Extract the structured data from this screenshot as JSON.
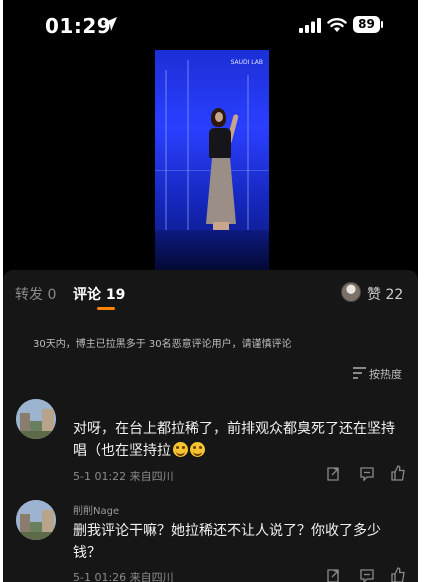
{
  "status_bar": {
    "time": "01:29",
    "battery": "89"
  },
  "video": {
    "watermark": "SAUDI LAB"
  },
  "tabs": {
    "repost_label": "转发 0",
    "comment_label": "评论 19",
    "like_label": "赞 22"
  },
  "notice": "30天内，博主已拉黑多于 30名恶意评论用户，请谨慎评论",
  "sort_label": "按热度",
  "comments": [
    {
      "text": "对呀，在台上都拉稀了，前排观众都臭死了还在坚持唱（也在坚持拉",
      "meta": "5-1 01:22 来自四川"
    },
    {
      "name": "削削Nage",
      "text": "删我评论干嘛？她拉稀还不让人说了？你收了多少钱？",
      "meta": "5-1 01:26 来自四川"
    }
  ],
  "colors": {
    "accent": "#ff8200",
    "panel_bg": "#161616",
    "stage_blue": "#2a3fff"
  },
  "icons": [
    "location-arrow-icon",
    "signal-icon",
    "wifi-icon",
    "sort-icon",
    "share-icon",
    "reply-icon",
    "thumbs-up-icon"
  ]
}
